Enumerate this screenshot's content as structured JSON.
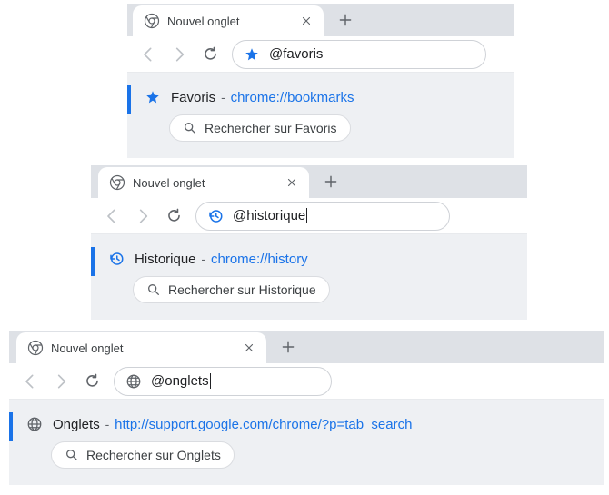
{
  "panels": [
    {
      "tab_title": "Nouvel onglet",
      "query": "@favoris",
      "icon": "star",
      "suggest_label": "Favoris",
      "suggest_url": "chrome://bookmarks",
      "chip_label": "Rechercher sur Favoris"
    },
    {
      "tab_title": "Nouvel onglet",
      "query": "@historique",
      "icon": "history",
      "suggest_label": "Historique",
      "suggest_url": "chrome://history",
      "chip_label": "Rechercher sur Historique"
    },
    {
      "tab_title": "Nouvel onglet",
      "query": "@onglets",
      "icon": "globe",
      "suggest_label": "Onglets",
      "suggest_url": "http://support.google.com/chrome/?p=tab_search",
      "chip_label": "Rechercher sur Onglets"
    }
  ]
}
